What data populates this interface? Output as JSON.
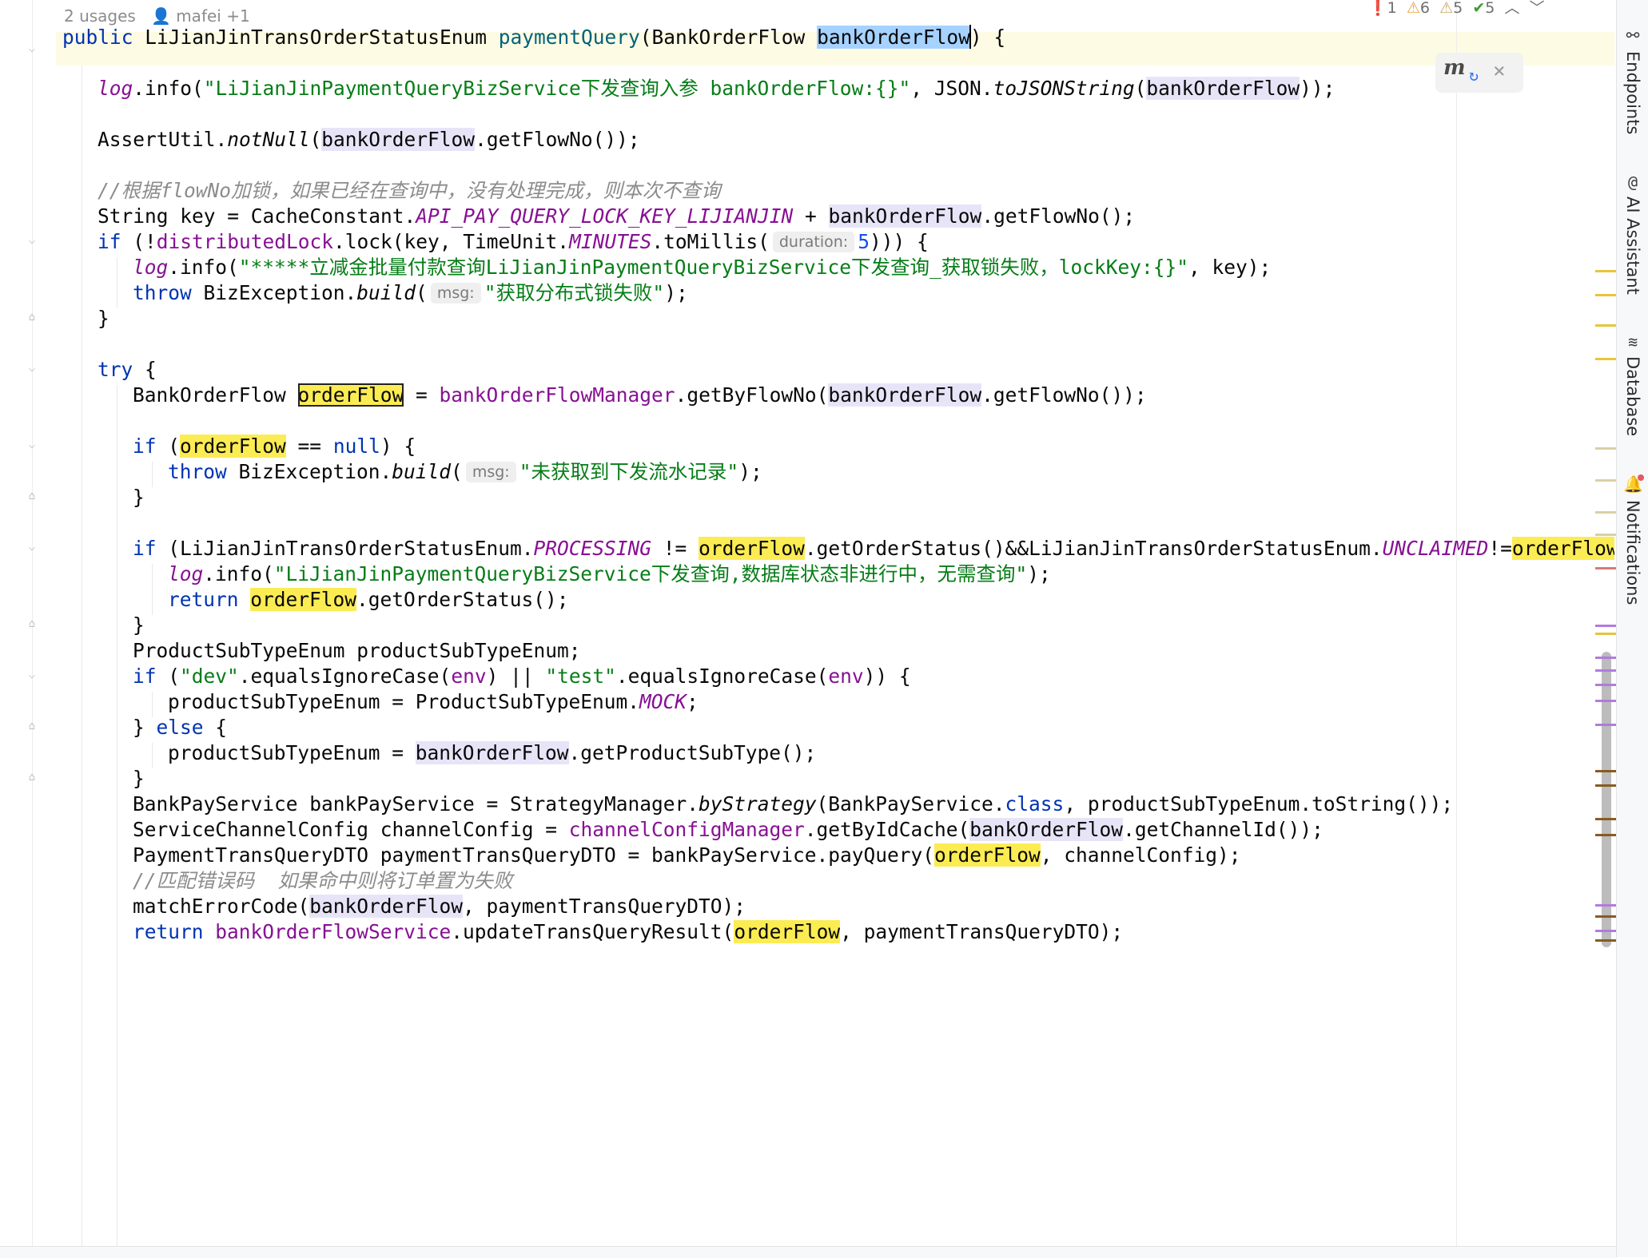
{
  "header": {
    "usages": "2 usages",
    "author": "mafei +1"
  },
  "inspections": {
    "errors": "1",
    "warnings": "6",
    "weak_warnings": "5",
    "typos": "5"
  },
  "popup": {
    "icon": "maven-reload-icon"
  },
  "tool_windows": [
    "Endpoints",
    "AI Assistant",
    "Database",
    "Notifications"
  ],
  "code": {
    "l1": {
      "mod": "public ",
      "type": "LiJianJinTransOrderStatusEnum ",
      "method": "paymentQuery",
      "open": "(BankOrderFlow ",
      "param": "bankOrderFlow",
      "close": ") {"
    },
    "l3": {
      "log": "log",
      "info": ".info(",
      "str": "\"LiJianJinPaymentQueryBizService下发查询入参 bankOrderFlow:{}\"",
      "mid": ", JSON.",
      "call": "toJSONString",
      "open": "(",
      "var": "bankOrderFlow",
      "close": "));"
    },
    "l5": {
      "cls": "AssertUtil.",
      "call": "notNull",
      "open": "(",
      "var": "bankOrderFlow",
      "close": ".getFlowNo());"
    },
    "l7": {
      "text": "//根据flowNo加锁，如果已经在查询中，没有处理完成，则本次不查询"
    },
    "l8": {
      "a": "String key = CacheConstant.",
      "const": "API_PAY_QUERY_LOCK_KEY_LIJIANJIN",
      "b": " + ",
      "var": "bankOrderFlow",
      "c": ".getFlowNo();"
    },
    "l9": {
      "kw": "if",
      "a": " (!",
      "fld": "distributedLock",
      "b": ".lock(key, TimeUnit.",
      "const": "MINUTES",
      "c": ".toMillis(",
      "hint": "duration:",
      "num": "5",
      "d": "))) {"
    },
    "l10": {
      "log": "log",
      "info": ".info(",
      "str": "\"*****立减金批量付款查询LiJianJinPaymentQueryBizService下发查询_获取锁失败，lockKey:{}\"",
      "rest": ", key);"
    },
    "l11": {
      "kw": "throw",
      "a": " BizException.",
      "call": "build",
      "open": "(",
      "hint": "msg:",
      "str": "\"获取分布式锁失败\"",
      "close": ");"
    },
    "l12": {
      "text": "}"
    },
    "l14": {
      "kw": "try",
      "rest": " {"
    },
    "l15": {
      "type": "BankOrderFlow ",
      "var": "orderFlow",
      "eq": " = ",
      "fld": "bankOrderFlowManager",
      "call": ".getByFlowNo(",
      "arg": "bankOrderFlow",
      "close": ".getFlowNo());"
    },
    "l17": {
      "kw": "if",
      "open": " (",
      "var": "orderFlow",
      "op": " == ",
      "kw2": "null",
      "close": ") {"
    },
    "l18": {
      "kw": "throw",
      "a": " BizException.",
      "call": "build",
      "open": "(",
      "hint": "msg:",
      "str": "\"未获取到下发流水记录\"",
      "close": ");"
    },
    "l19": {
      "text": "}"
    },
    "l21": {
      "kw": "if",
      "a": " (LiJianJinTransOrderStatusEnum.",
      "const1": "PROCESSING",
      "b": " != ",
      "var1": "orderFlow",
      "c": ".getOrderStatus()&&LiJianJinTransOrderStatusEnum.",
      "const2": "UNCLAIMED",
      "d": "!=",
      "var2": "orderFlow",
      "e": "."
    },
    "l22": {
      "log": "log",
      "info": ".info(",
      "str": "\"LiJianJinPaymentQueryBizService下发查询,数据库状态非进行中，无需查询\"",
      "close": ");"
    },
    "l23": {
      "kw": "return",
      "sp": " ",
      "var": "orderFlow",
      "rest": ".getOrderStatus();"
    },
    "l24": {
      "text": "}"
    },
    "l25": {
      "text": "ProductSubTypeEnum productSubTypeEnum;"
    },
    "l26": {
      "kw": "if",
      "a": " (",
      "str1": "\"dev\"",
      "b": ".equalsIgnoreCase(",
      "fld1": "env",
      "c": ") || ",
      "str2": "\"test\"",
      "d": ".equalsIgnoreCase(",
      "fld2": "env",
      "e": ")) {"
    },
    "l27": {
      "a": "productSubTypeEnum = ProductSubTypeEnum.",
      "const": "MOCK",
      "b": ";"
    },
    "l28": {
      "a": "} ",
      "kw": "else",
      "b": " {"
    },
    "l29": {
      "a": "productSubTypeEnum = ",
      "var": "bankOrderFlow",
      "b": ".getProductSubType();"
    },
    "l30": {
      "text": "}"
    },
    "l31": {
      "a": "BankPayService bankPayService = StrategyManager.",
      "call": "byStrategy",
      "b": "(BankPayService.",
      "kw": "class",
      "c": ", productSubTypeEnum.toString());"
    },
    "l32": {
      "a": "ServiceChannelConfig channelConfig = ",
      "fld": "channelConfigManager",
      "b": ".getByIdCache(",
      "var": "bankOrderFlow",
      "c": ".getChannelId());"
    },
    "l33": {
      "a": "PaymentTransQueryDTO paymentTransQueryDTO = bankPayService.payQuery(",
      "var": "orderFlow",
      "b": ", channelConfig);"
    },
    "l34": {
      "text": "//匹配错误码  如果命中则将订单置为失败"
    },
    "l35": {
      "a": "matchErrorCode(",
      "var": "bankOrderFlow",
      "b": ", paymentTransQueryDTO);"
    },
    "l36": {
      "kw": "return",
      "sp": " ",
      "fld": "bankOrderFlowService",
      "a": ".updateTransQueryResult(",
      "var": "orderFlow",
      "b": ", paymentTransQueryDTO);"
    }
  },
  "colors": {
    "keyword": "#0033b3",
    "string": "#067d17",
    "field": "#871094",
    "method_decl": "#00627a",
    "number": "#1750eb",
    "comment": "#8c8c8c",
    "read_highlight": "#fcec53",
    "selection": "#a6d2ff"
  }
}
